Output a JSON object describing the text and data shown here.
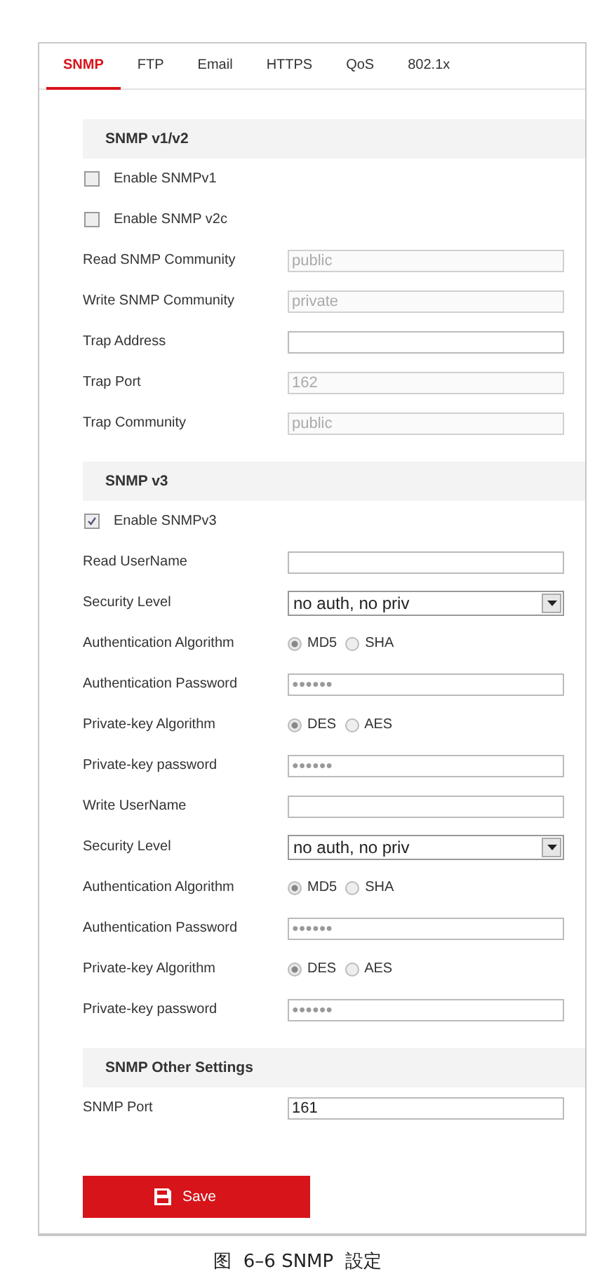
{
  "tabs": [
    {
      "label": "SNMP",
      "selected": true
    },
    {
      "label": "FTP",
      "selected": false
    },
    {
      "label": "Email",
      "selected": false
    },
    {
      "label": "HTTPS",
      "selected": false
    },
    {
      "label": "QoS",
      "selected": false
    },
    {
      "label": "802.1x",
      "selected": false
    }
  ],
  "sections": [
    {
      "title": "SNMP v1/v2",
      "rows": [
        {
          "kind": "checkbox",
          "label": "Enable SNMPv1",
          "checked": false
        },
        {
          "kind": "checkbox",
          "label": "Enable SNMP v2c",
          "checked": false
        },
        {
          "kind": "text",
          "label": "Read SNMP Community",
          "value": "public",
          "disabled": true
        },
        {
          "kind": "text",
          "label": "Write SNMP Community",
          "value": "private",
          "disabled": true
        },
        {
          "kind": "text",
          "label": "Trap Address",
          "disabled": false
        },
        {
          "kind": "text",
          "label": "Trap Port",
          "value": "162",
          "disabled": true
        },
        {
          "kind": "text",
          "label": "Trap Community",
          "value": "public",
          "disabled": true
        }
      ]
    },
    {
      "title": "SNMP v3",
      "rows": [
        {
          "kind": "checkbox",
          "label": "Enable SNMPv3",
          "checked": true
        },
        {
          "kind": "text",
          "label": "Read UserName",
          "disabled": false
        },
        {
          "kind": "select",
          "label": "Security Level",
          "value": "no auth, no priv"
        },
        {
          "kind": "radio",
          "label": "Authentication Algorithm",
          "options": [
            {
              "label": "MD5",
              "selected": true
            },
            {
              "label": "SHA",
              "selected": false
            }
          ]
        },
        {
          "kind": "password",
          "label": "Authentication Password",
          "value": "●●●●●●"
        },
        {
          "kind": "radio",
          "label": "Private-key Algorithm",
          "options": [
            {
              "label": "DES",
              "selected": true
            },
            {
              "label": "AES",
              "selected": false
            }
          ]
        },
        {
          "kind": "password",
          "label": "Private-key password",
          "value": "●●●●●●"
        },
        {
          "kind": "text",
          "label": "Write UserName",
          "disabled": false
        },
        {
          "kind": "select",
          "label": "Security Level",
          "value": "no auth, no priv"
        },
        {
          "kind": "radio",
          "label": "Authentication Algorithm",
          "options": [
            {
              "label": "MD5",
              "selected": true
            },
            {
              "label": "SHA",
              "selected": false
            }
          ]
        },
        {
          "kind": "password",
          "label": "Authentication Password",
          "value": "●●●●●●"
        },
        {
          "kind": "radio",
          "label": "Private-key Algorithm",
          "options": [
            {
              "label": "DES",
              "selected": true
            },
            {
              "label": "AES",
              "selected": false
            }
          ]
        },
        {
          "kind": "password",
          "label": "Private-key password",
          "value": "●●●●●●"
        }
      ]
    },
    {
      "title": "SNMP Other Settings",
      "rows": [
        {
          "kind": "text",
          "label": "SNMP Port",
          "value": "161",
          "disabled": false
        }
      ]
    }
  ],
  "save_button": "Save",
  "caption": "图  6–6 SNMP  設定"
}
